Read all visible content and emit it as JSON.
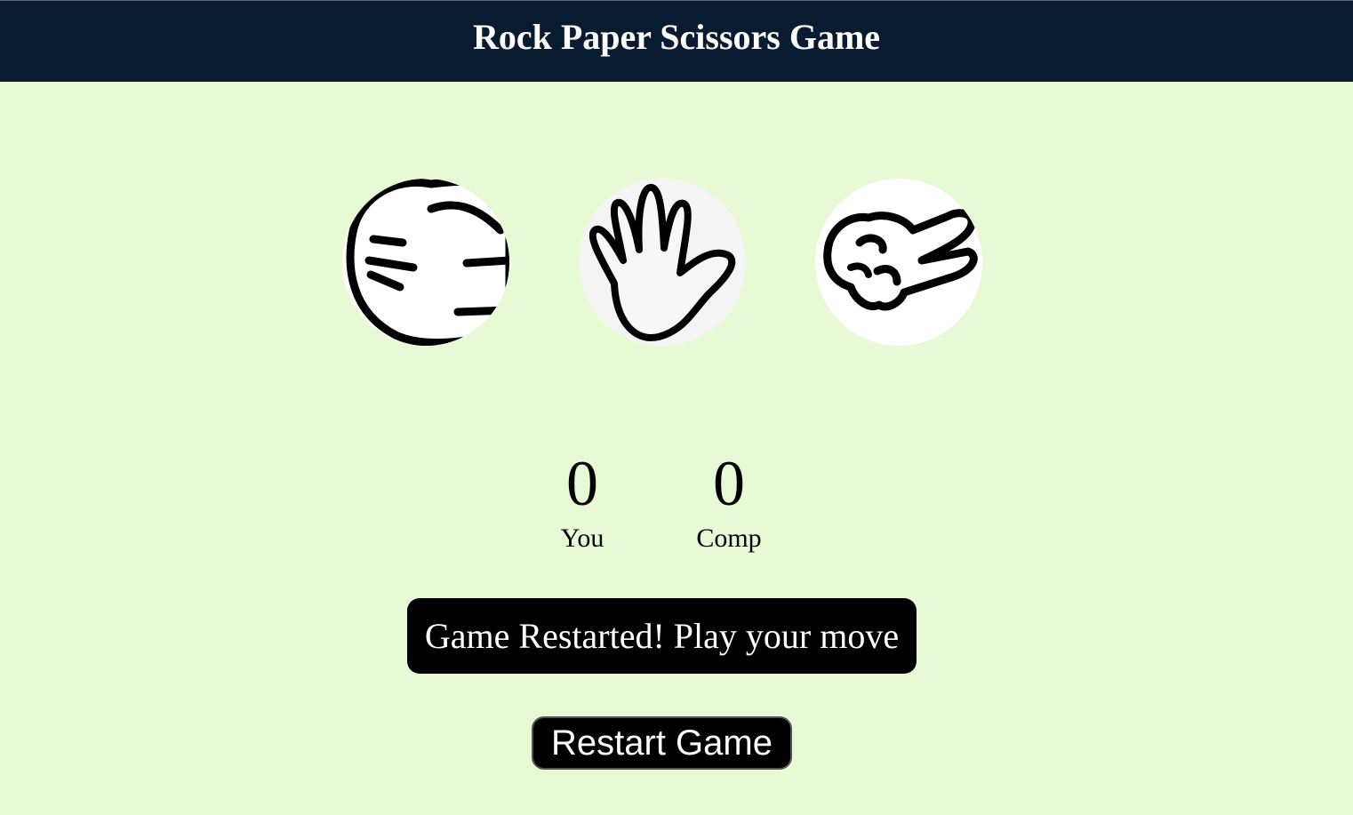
{
  "header": {
    "title": "Rock Paper Scissors Game"
  },
  "choices": [
    {
      "id": "rock",
      "icon": "rock-fist-icon"
    },
    {
      "id": "paper",
      "icon": "paper-hand-icon"
    },
    {
      "id": "scissors",
      "icon": "scissors-hand-icon"
    }
  ],
  "scoreboard": {
    "user_score": "0",
    "user_label": "You",
    "comp_score": "0",
    "comp_label": "Comp"
  },
  "message": "Game Restarted! Play your move",
  "restart_button_label": "Restart Game",
  "colors": {
    "header_bg": "#081b31",
    "page_bg": "#e8f9d6",
    "message_bg": "#000000",
    "button_bg": "#000000"
  }
}
